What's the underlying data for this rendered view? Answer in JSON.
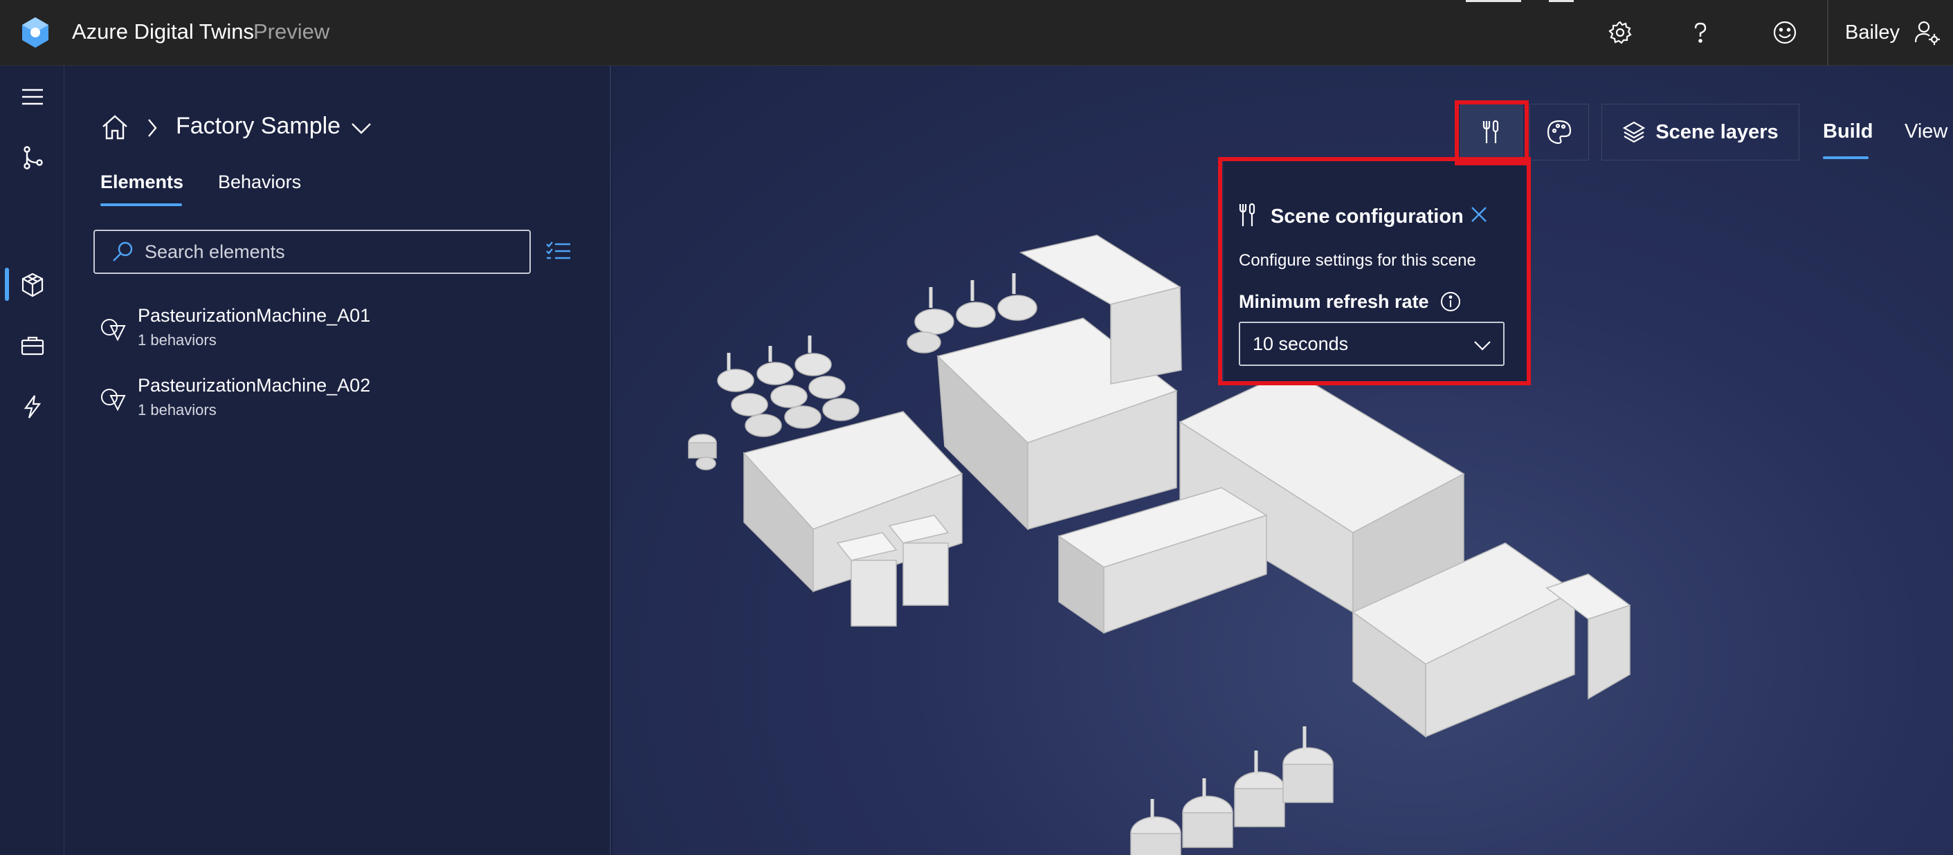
{
  "header": {
    "app_title": "Azure Digital Twins",
    "app_badge": "Preview",
    "user_name": "Bailey",
    "icons": [
      "settings-icon",
      "help-icon",
      "feedback-smile-icon",
      "user-settings-icon"
    ]
  },
  "rail": {
    "icons": [
      "menu-icon",
      "twin-graph-icon",
      "3d-scenes-icon",
      "toolbox-icon",
      "events-icon"
    ],
    "active_index": 2
  },
  "panel": {
    "breadcrumb_title": "Factory Sample",
    "tabs": [
      {
        "label": "Elements",
        "active": true
      },
      {
        "label": "Behaviors",
        "active": false
      }
    ],
    "search_placeholder": "Search elements",
    "elements": [
      {
        "name": "PasteurizationMachine_A01",
        "behaviors": "1 behaviors"
      },
      {
        "name": "PasteurizationMachine_A02",
        "behaviors": "1 behaviors"
      }
    ]
  },
  "toolbar": {
    "scene_layers_label": "Scene layers",
    "modes": [
      {
        "label": "Build",
        "active": true
      },
      {
        "label": "View",
        "active": false
      }
    ]
  },
  "scene_config": {
    "title": "Scene configuration",
    "description": "Configure settings for this scene",
    "refresh_label": "Minimum refresh rate",
    "refresh_value": "10 seconds"
  },
  "colors": {
    "accent": "#4ea4f5",
    "highlight": "#e3141e",
    "panel_bg": "#1b2240",
    "topbar_bg": "#242424"
  }
}
